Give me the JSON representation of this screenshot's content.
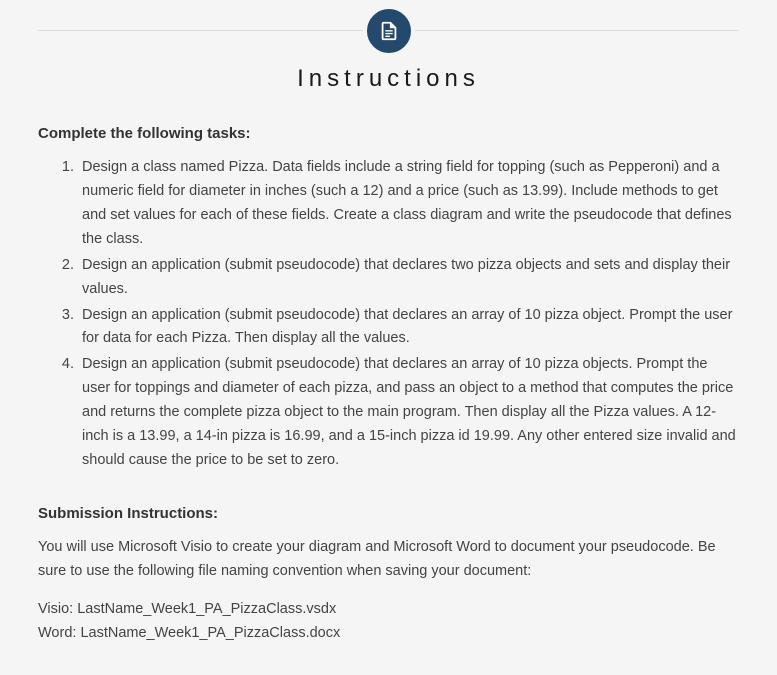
{
  "title": "Instructions",
  "tasks_heading": "Complete the following tasks:",
  "tasks": [
    "Design a class named Pizza. Data fields include a string field for topping (such as Pepperoni) and a numeric field for diameter in inches (such a 12) and a price (such as 13.99). Include methods to get and set values for each of these fields. Create a class diagram and write the pseudocode that defines the class.",
    "Design an application (submit pseudocode) that declares two pizza objects and sets and display their values.",
    "Design an application (submit pseudocode) that declares an array of 10 pizza object. Prompt the user for data for each Pizza. Then display all the values.",
    "Design an application (submit pseudocode) that declares an array of 10 pizza objects. Prompt the user for toppings and diameter of each pizza, and pass an object to a method that computes the price and returns the complete pizza object to the main program. Then display all the Pizza values. A 12-inch is a 13.99, a 14-in pizza is 16.99, and a 15-inch pizza id 19.99. Any other entered size invalid and should cause the price to be set to zero."
  ],
  "submission_heading": "Submission Instructions:",
  "submission_para": "You will use Microsoft Visio to create your diagram and Microsoft Word to document your pseudocode. Be sure to use the following file naming convention when saving your document:",
  "file_visio": "Visio: LastName_Week1_PA_PizzaClass.vsdx",
  "file_word": "Word: LastName_Week1_PA_PizzaClass.docx"
}
